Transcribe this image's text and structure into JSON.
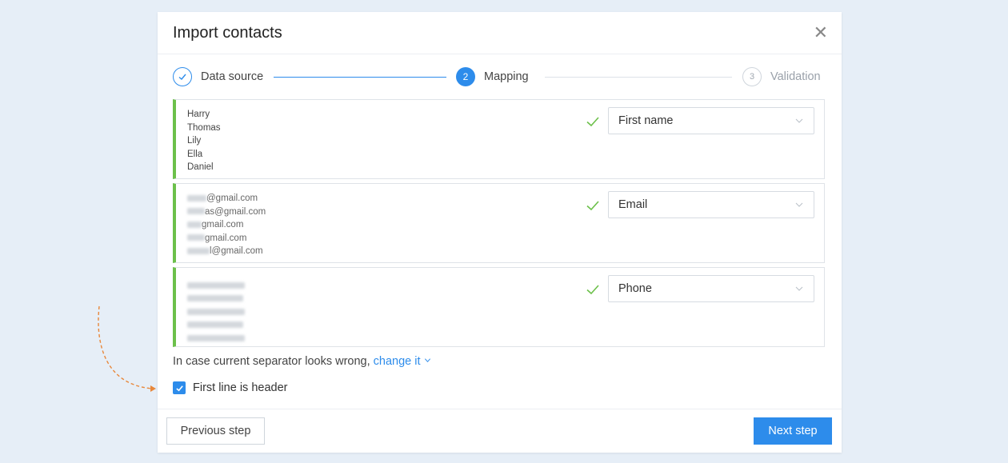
{
  "dialog": {
    "title": "Import contacts",
    "close_icon": "close-icon"
  },
  "stepper": {
    "steps": [
      {
        "label": "Data source",
        "state": "done",
        "marker": "✓"
      },
      {
        "label": "Mapping",
        "state": "active",
        "marker": "2"
      },
      {
        "label": "Validation",
        "state": "todo",
        "marker": "3"
      }
    ]
  },
  "columns": [
    {
      "samples": [
        "Harry",
        "Thomas",
        "Lily",
        "Ella",
        "Daniel"
      ],
      "mapped_to": "First name"
    },
    {
      "samples": [
        "@gmail.com",
        "as@gmail.com",
        "gmail.com",
        "gmail.com",
        "l@gmail.com"
      ],
      "mapped_to": "Email"
    },
    {
      "samples": [],
      "mapped_to": "Phone"
    }
  ],
  "separator_note": {
    "text": "In case current separator looks wrong, ",
    "link": "change it"
  },
  "header_option": {
    "label": "First line is header",
    "checked": true
  },
  "footer": {
    "previous_label": "Previous step",
    "next_label": "Next step"
  },
  "colors": {
    "accent": "#2d8ceb",
    "success": "#6cc04a",
    "annotation": "#e8873a"
  }
}
